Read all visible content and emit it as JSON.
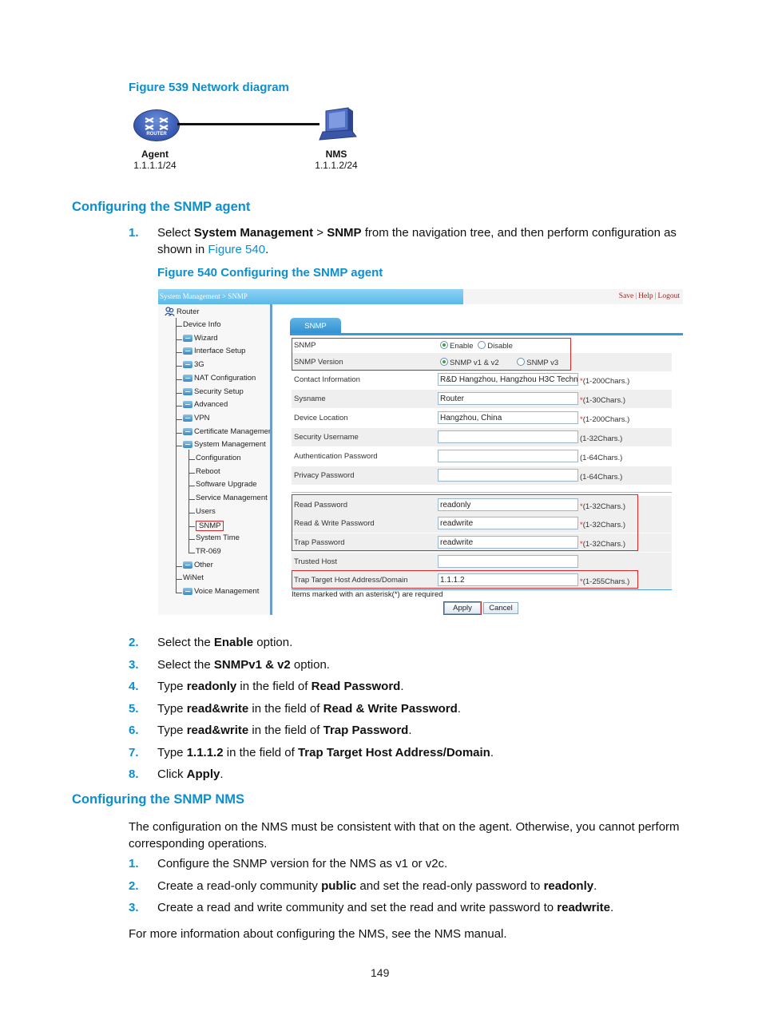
{
  "figure539": {
    "caption": "Figure 539 Network diagram",
    "agent": {
      "name": "Agent",
      "ip": "1.1.1.1/24",
      "icon_text": "ROUTER"
    },
    "nms": {
      "name": "NMS",
      "ip": "1.1.1.2/24"
    }
  },
  "section1": {
    "heading": "Configuring the SNMP agent",
    "step1": {
      "num": "1.",
      "pre": "Select ",
      "b1": "System Management",
      "mid1": " > ",
      "b2": "SNMP",
      "post": " from the navigation tree, and then perform configuration as",
      "line2_pre": "shown in ",
      "line2_link": "Figure 540",
      "line2_post": "."
    },
    "figure540_caption": "Figure 540 Configuring the SNMP agent"
  },
  "ui": {
    "breadcrumb": "System Management > SNMP",
    "toplinks": {
      "save": "Save",
      "help": "Help",
      "logout": "Logout"
    },
    "tree": {
      "root": "Router",
      "items": [
        {
          "label": "Device Info",
          "folder": false,
          "level": 1
        },
        {
          "label": "Wizard",
          "folder": true,
          "level": 1
        },
        {
          "label": "Interface Setup",
          "folder": true,
          "level": 1
        },
        {
          "label": "3G",
          "folder": true,
          "level": 1
        },
        {
          "label": "NAT Configuration",
          "folder": true,
          "level": 1
        },
        {
          "label": "Security Setup",
          "folder": true,
          "level": 1
        },
        {
          "label": "Advanced",
          "folder": true,
          "level": 1
        },
        {
          "label": "VPN",
          "folder": true,
          "level": 1
        },
        {
          "label": "Certificate Managemer",
          "folder": true,
          "level": 1
        },
        {
          "label": "System Management",
          "folder": true,
          "level": 1
        },
        {
          "label": "Configuration",
          "folder": false,
          "level": 2
        },
        {
          "label": "Reboot",
          "folder": false,
          "level": 2
        },
        {
          "label": "Software Upgrade",
          "folder": false,
          "level": 2
        },
        {
          "label": "Service Management",
          "folder": false,
          "level": 2
        },
        {
          "label": "Users",
          "folder": false,
          "level": 2
        },
        {
          "label": "SNMP",
          "folder": false,
          "level": 2,
          "selected": true
        },
        {
          "label": "System Time",
          "folder": false,
          "level": 2
        },
        {
          "label": "TR-069",
          "folder": false,
          "level": 2
        },
        {
          "label": "Other",
          "folder": true,
          "level": 1
        },
        {
          "label": "WiNet",
          "folder": false,
          "level": 1
        },
        {
          "label": "Voice Management",
          "folder": true,
          "level": 1
        }
      ]
    },
    "tab": "SNMP",
    "snmp_row": {
      "label": "SNMP",
      "enable": "Enable",
      "disable": "Disable",
      "selected": "Enable"
    },
    "version_row": {
      "label": "SNMP Version",
      "v1v2": "SNMP v1 & v2",
      "v3": "SNMP v3",
      "selected": "SNMP v1 & v2"
    },
    "rows": [
      {
        "label": "Contact Information",
        "value": "R&D Hangzhou, Hangzhou H3C Techn",
        "required": true,
        "hint": "(1-200Chars.)"
      },
      {
        "label": "Sysname",
        "value": "Router",
        "required": true,
        "hint": "(1-30Chars.)"
      },
      {
        "label": "Device Location",
        "value": "Hangzhou, China",
        "required": true,
        "hint": "(1-200Chars.)"
      },
      {
        "label": "Security Username",
        "value": "",
        "required": false,
        "hint": "(1-32Chars.)"
      },
      {
        "label": "Authentication Password",
        "value": "",
        "required": false,
        "hint": "(1-64Chars.)"
      },
      {
        "label": "Privacy Password",
        "value": "",
        "required": false,
        "hint": "(1-64Chars.)"
      },
      {
        "label": "Read Password",
        "value": "readonly",
        "required": true,
        "hint": "(1-32Chars.)"
      },
      {
        "label": "Read & Write Password",
        "value": "readwrite",
        "required": true,
        "hint": "(1-32Chars.)"
      },
      {
        "label": "Trap Password",
        "value": "readwrite",
        "required": true,
        "hint": "(1-32Chars.)"
      },
      {
        "label": "Trusted Host",
        "value": "",
        "required": false,
        "hint": ""
      },
      {
        "label": "Trap Target Host Address/Domain",
        "value": "1.1.1.2",
        "required": true,
        "hint": "(1-255Chars.)"
      }
    ],
    "star": "*",
    "note": "Items marked with an asterisk(*) are required",
    "apply": "Apply",
    "cancel": "Cancel"
  },
  "steps": [
    {
      "num": "2.",
      "parts": [
        [
          "Select the ",
          false
        ],
        [
          "Enable",
          true
        ],
        [
          " option.",
          false
        ]
      ]
    },
    {
      "num": "3.",
      "parts": [
        [
          "Select the ",
          false
        ],
        [
          "SNMPv1 & v2",
          true
        ],
        [
          " option.",
          false
        ]
      ]
    },
    {
      "num": "4.",
      "parts": [
        [
          "Type ",
          false
        ],
        [
          "readonly",
          true
        ],
        [
          " in the field of ",
          false
        ],
        [
          "Read Password",
          true
        ],
        [
          ".",
          false
        ]
      ]
    },
    {
      "num": "5.",
      "parts": [
        [
          "Type ",
          false
        ],
        [
          "read&write",
          true
        ],
        [
          " in the field of ",
          false
        ],
        [
          "Read & Write Password",
          true
        ],
        [
          ".",
          false
        ]
      ]
    },
    {
      "num": "6.",
      "parts": [
        [
          "Type ",
          false
        ],
        [
          "read&write",
          true
        ],
        [
          " in the field of ",
          false
        ],
        [
          "Trap Password",
          true
        ],
        [
          ".",
          false
        ]
      ]
    },
    {
      "num": "7.",
      "parts": [
        [
          "Type ",
          false
        ],
        [
          "1.1.1.2",
          true
        ],
        [
          " in the field of ",
          false
        ],
        [
          "Trap Target Host Address/Domain",
          true
        ],
        [
          ".",
          false
        ]
      ]
    },
    {
      "num": "8.",
      "parts": [
        [
          "Click ",
          false
        ],
        [
          "Apply",
          true
        ],
        [
          ".",
          false
        ]
      ]
    }
  ],
  "section2": {
    "heading": "Configuring the SNMP NMS",
    "intro_line1": "The configuration on the NMS must be consistent with that on the agent. Otherwise, you cannot perform",
    "intro_line2": "corresponding operations.",
    "steps": [
      {
        "num": "1.",
        "parts": [
          [
            "Configure the SNMP version for the NMS as v1 or v2c.",
            false
          ]
        ]
      },
      {
        "num": "2.",
        "parts": [
          [
            "Create a read-only community ",
            false
          ],
          [
            "public",
            true
          ],
          [
            " and set the read-only password to ",
            false
          ],
          [
            "readonly",
            true
          ],
          [
            ".",
            false
          ]
        ]
      },
      {
        "num": "3.",
        "parts": [
          [
            "Create a read and write community and set the read and write password to ",
            false
          ],
          [
            "readwrite",
            true
          ],
          [
            ".",
            false
          ]
        ]
      }
    ],
    "outro": "For more information about configuring the NMS, see the NMS manual."
  },
  "page_number": "149"
}
